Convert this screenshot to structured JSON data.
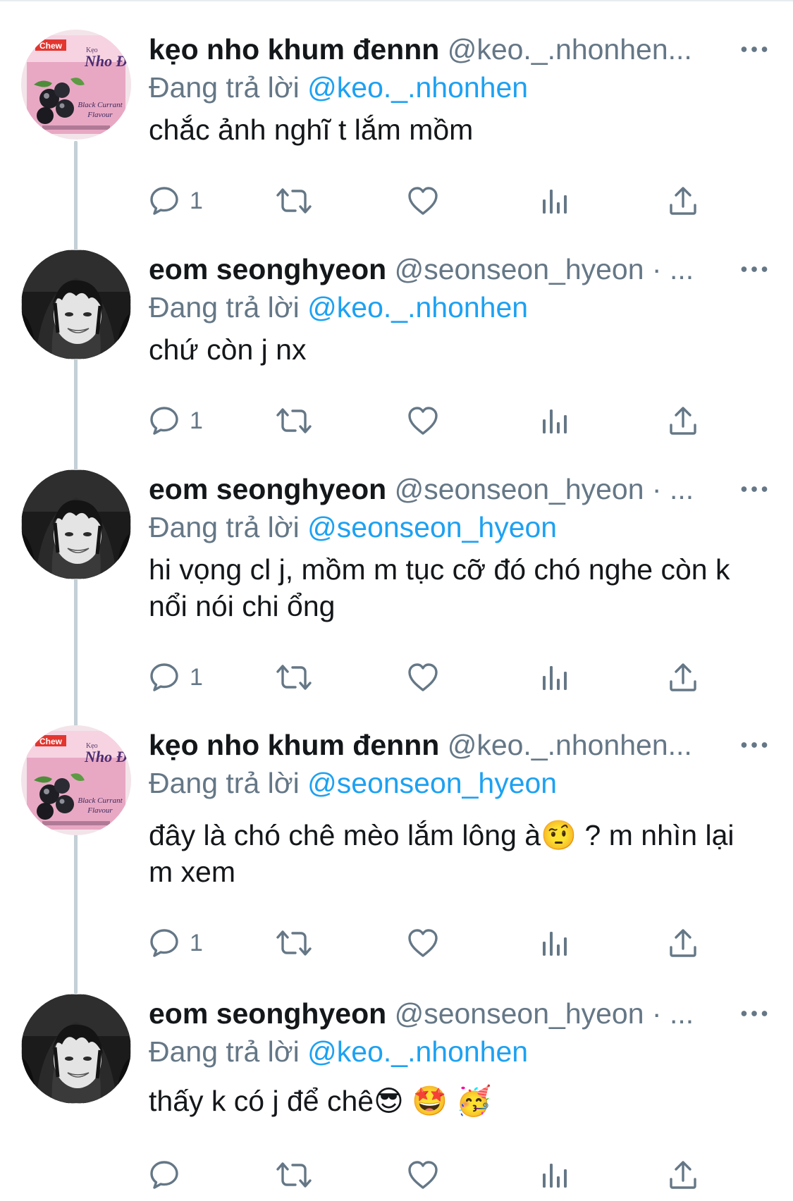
{
  "reply_prefix": "Đang trả lời",
  "tweets": [
    {
      "name": "kẹo nho khum đennn",
      "handle": "@keo._.nhonhen...",
      "reply_to": "@keo._.nhonhen",
      "text": "chắc ảnh nghĩ t lắm mồm",
      "reply_count": "1",
      "avatar": "keo-nho-den-candy-avatar"
    },
    {
      "name": "eom seonghyeon",
      "handle": "@seonseon_hyeon · ...",
      "reply_to": "@keo._.nhonhen",
      "text": "chứ còn j nx",
      "reply_count": "1",
      "avatar": "grayscale-portrait-avatar"
    },
    {
      "name": "eom seonghyeon",
      "handle": "@seonseon_hyeon · ...",
      "reply_to": "@seonseon_hyeon",
      "text": "hi vọng cl j, mồm m tục cỡ đó chó nghe còn k nổi nói chi ổng",
      "reply_count": "1",
      "avatar": "grayscale-portrait-avatar"
    },
    {
      "name": "kẹo nho khum đennn",
      "handle": "@keo._.nhonhen...",
      "reply_to": "@seonseon_hyeon",
      "text": "đây là chó chê mèo lắm lông à🤨 ? m nhìn lại m xem",
      "reply_count": "1",
      "avatar": "keo-nho-den-candy-avatar"
    },
    {
      "name": "eom seonghyeon",
      "handle": "@seonseon_hyeon · ...",
      "reply_to": "@keo._.nhonhen",
      "text": "thấy k có j để chê😎 🤩 🥳",
      "reply_count": "",
      "avatar": "grayscale-portrait-avatar"
    }
  ],
  "candy_avatar": {
    "brand_text": "Nho Đen",
    "flavour_text": "Black Currant Flavour",
    "small_text": "Kẹo"
  },
  "colors": {
    "text": "#14171a",
    "secondary": "#657786",
    "mention": "#1da1f2",
    "thread_line": "#c4cfd6"
  },
  "icons": [
    "more-icon",
    "reply-icon",
    "retweet-icon",
    "like-icon",
    "analytics-icon",
    "share-icon"
  ]
}
